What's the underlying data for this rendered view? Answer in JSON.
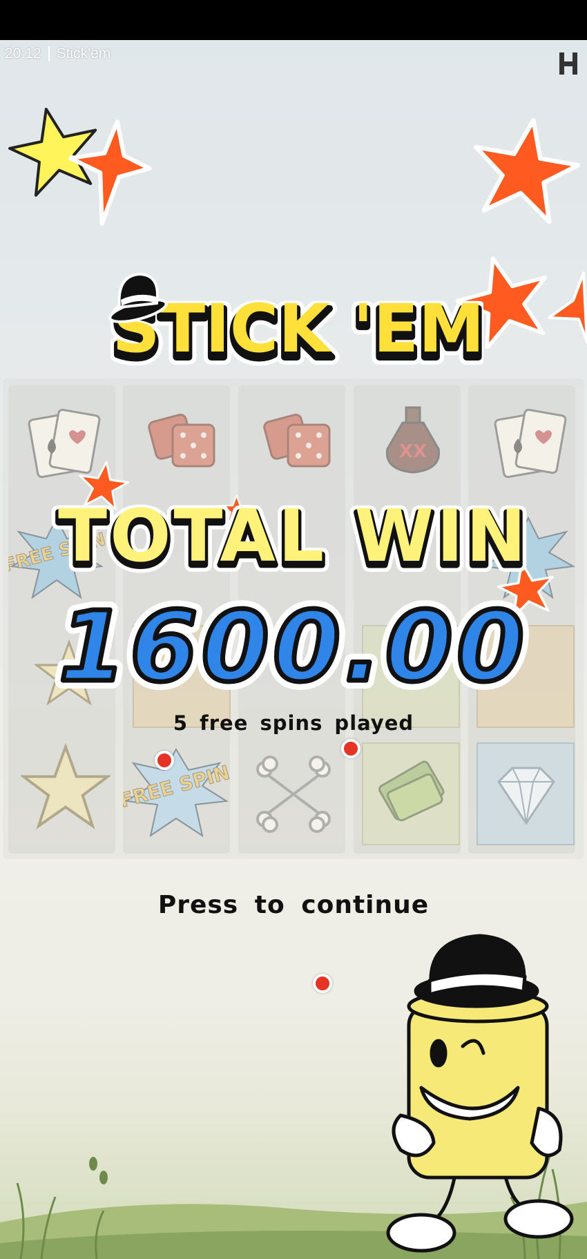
{
  "status_bar": {
    "time": "20:12",
    "app_name": "Stick'em"
  },
  "logo": {
    "text": "STICK 'EM"
  },
  "win_popup": {
    "title": "TOTAL WIN",
    "amount": "1600.00",
    "subtitle": "5 free spins played",
    "continue_label": "Press to continue"
  },
  "reels": [
    [
      "cards",
      "free-spin",
      "star",
      "star"
    ],
    [
      "dice",
      "star",
      "money",
      "free-spin"
    ],
    [
      "dice",
      "fist",
      "bomb",
      "bones"
    ],
    [
      "potion",
      "bomb",
      "money",
      "money"
    ],
    [
      "cards",
      "free-spin",
      "bomb",
      "diamond"
    ]
  ],
  "symbol_labels": {
    "free_spin": "FREE SPIN"
  },
  "colors": {
    "star_red": "#ff5a1f",
    "star_yellow": "#fff45a",
    "title_yellow": "#fff27a",
    "amount_blue": "#2f86e8",
    "logo_yellow": "#ffe03a"
  },
  "icons": [
    "provider-logo-icon",
    "star-icon",
    "hat-icon"
  ]
}
